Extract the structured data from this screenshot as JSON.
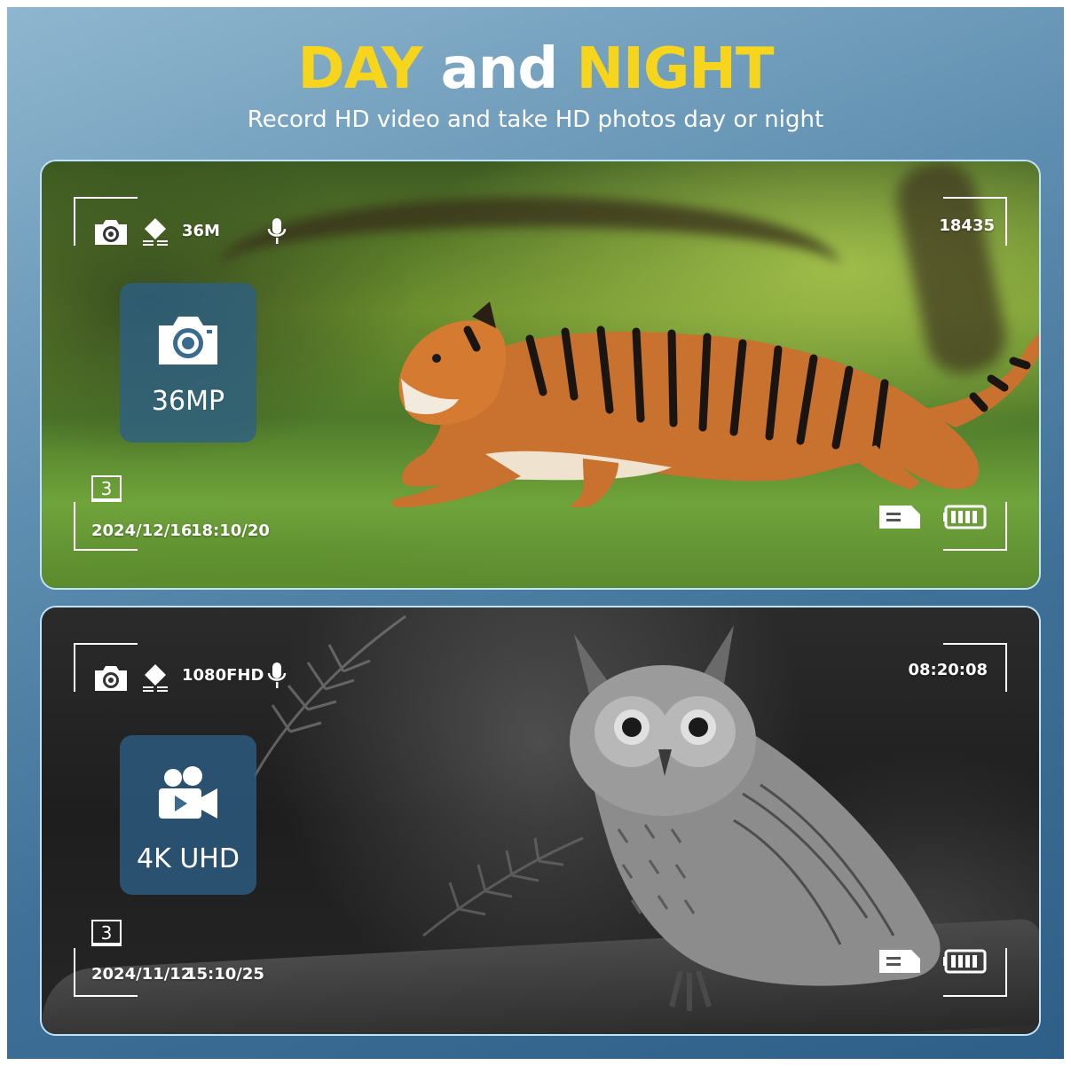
{
  "header": {
    "title_day": "DAY",
    "title_and": "and",
    "title_night": "NIGHT",
    "subtitle": "Record HD video and take HD photos day or night"
  },
  "colors": {
    "accent_yellow": "#f7d51d",
    "panel_border": "#bfe3f7",
    "mode_box": "#2d5f87"
  },
  "panels": [
    {
      "id": "day",
      "resolution": "36M",
      "counter": "18435",
      "mode_label": "36MP",
      "mode_icon": "camera-icon",
      "frame_number": "3",
      "date": "2024/12/16",
      "time": "18:10/20"
    },
    {
      "id": "night",
      "resolution": "1080FHD",
      "counter": "08:20:08",
      "mode_label": "4K UHD",
      "mode_icon": "video-camera-icon",
      "frame_number": "3",
      "date": "2024/11/12",
      "time": "15:10/25"
    }
  ]
}
